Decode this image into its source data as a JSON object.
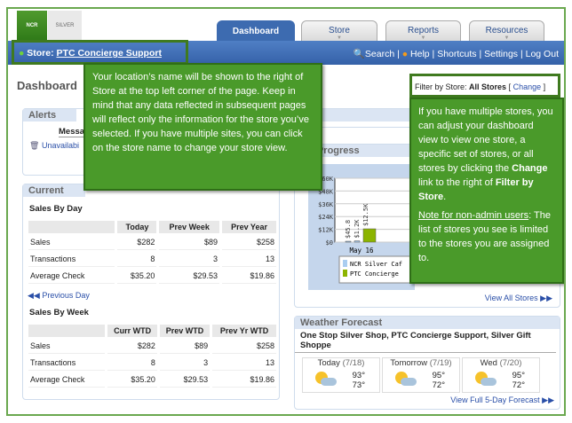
{
  "header": {
    "logo_ncr": "NCR",
    "logo_silver": "SILVER",
    "tabs": [
      {
        "label": "Dashboard",
        "active": true
      },
      {
        "label": "Store"
      },
      {
        "label": "Reports"
      },
      {
        "label": "Resources"
      }
    ]
  },
  "navbar": {
    "store_prefix": "Store:",
    "store_name": "PTC Concierge Support",
    "links": [
      "Search",
      "Help",
      "Shortcuts",
      "Settings",
      "Log Out"
    ]
  },
  "page_title": "Dashboard",
  "filter": {
    "label": "Filter by Store:",
    "value": "All Stores",
    "change": "Change"
  },
  "alerts": {
    "title": "Alerts",
    "column": "Message",
    "item": "Unavailabi"
  },
  "current": {
    "title": "Current",
    "by_day": {
      "title": "Sales By Day",
      "headers": [
        "",
        "Today",
        "Prev Week",
        "Prev Year"
      ],
      "rows": [
        [
          "Sales",
          "$282",
          "$89",
          "$258"
        ],
        [
          "Transactions",
          "8",
          "3",
          "13"
        ],
        [
          "Average Check",
          "$35.20",
          "$29.53",
          "$19.86"
        ]
      ]
    },
    "prev_day": "Previous Day",
    "by_week": {
      "title": "Sales By Week",
      "headers": [
        "",
        "Curr WTD",
        "Prev WTD",
        "Prev Yr WTD"
      ],
      "rows": [
        [
          "Sales",
          "$282",
          "$89",
          "$258"
        ],
        [
          "Transactions",
          "8",
          "3",
          "13"
        ],
        [
          "Average Check",
          "$35.20",
          "$29.53",
          "$19.86"
        ]
      ]
    }
  },
  "progress": {
    "title": "hly Progress",
    "yticks": [
      "$60K",
      "$48K",
      "$36K",
      "$24K",
      "$12K",
      "$0"
    ],
    "xlabel": "May 16",
    "bars": [
      {
        "label": "$45.8",
        "value": 45.8,
        "color": "#a9cdf0"
      },
      {
        "label": "$1.2K",
        "value": 1200,
        "color": "#a9cdf0"
      },
      {
        "label": "$12.5K",
        "value": 12500,
        "color": "#8cb400"
      }
    ],
    "legend": [
      "NCR Silver Caf",
      "PTC Concierge"
    ],
    "view_all": "View All Stores"
  },
  "weather": {
    "title": "Weather Forecast",
    "locations": "One Stop Silver Shop, PTC Concierge Support, Silver Gift Shoppe",
    "days": [
      {
        "day": "Today",
        "date": "(7/18)",
        "hi": "93°",
        "lo": "73°"
      },
      {
        "day": "Tomorrow",
        "date": "(7/19)",
        "hi": "95°",
        "lo": "72°"
      },
      {
        "day": "Wed",
        "date": "(7/20)",
        "hi": "95°",
        "lo": "72°"
      }
    ],
    "full": "View Full 5-Day Forecast"
  },
  "tip_left": "Your location’s name will be shown to the right of Store at the top left corner of the page.  Keep in mind that any data reflected in subsequent pages will reflect only the information for the store you’ve selected.  If you have multiple sites, you can click on the store name to change your store view.",
  "tip_right": {
    "p1a": "If you have multiple stores, you can adjust your dashboard view to view one store, a specific set of stores, or all stores by clicking the ",
    "change": "Change",
    "p1b": " link to the right of ",
    "filter": "Filter by Store",
    "p1c": ".",
    "note": "Note for non-admin users",
    "p2": "The list of stores you see is limited to the stores you are assigned to."
  }
}
